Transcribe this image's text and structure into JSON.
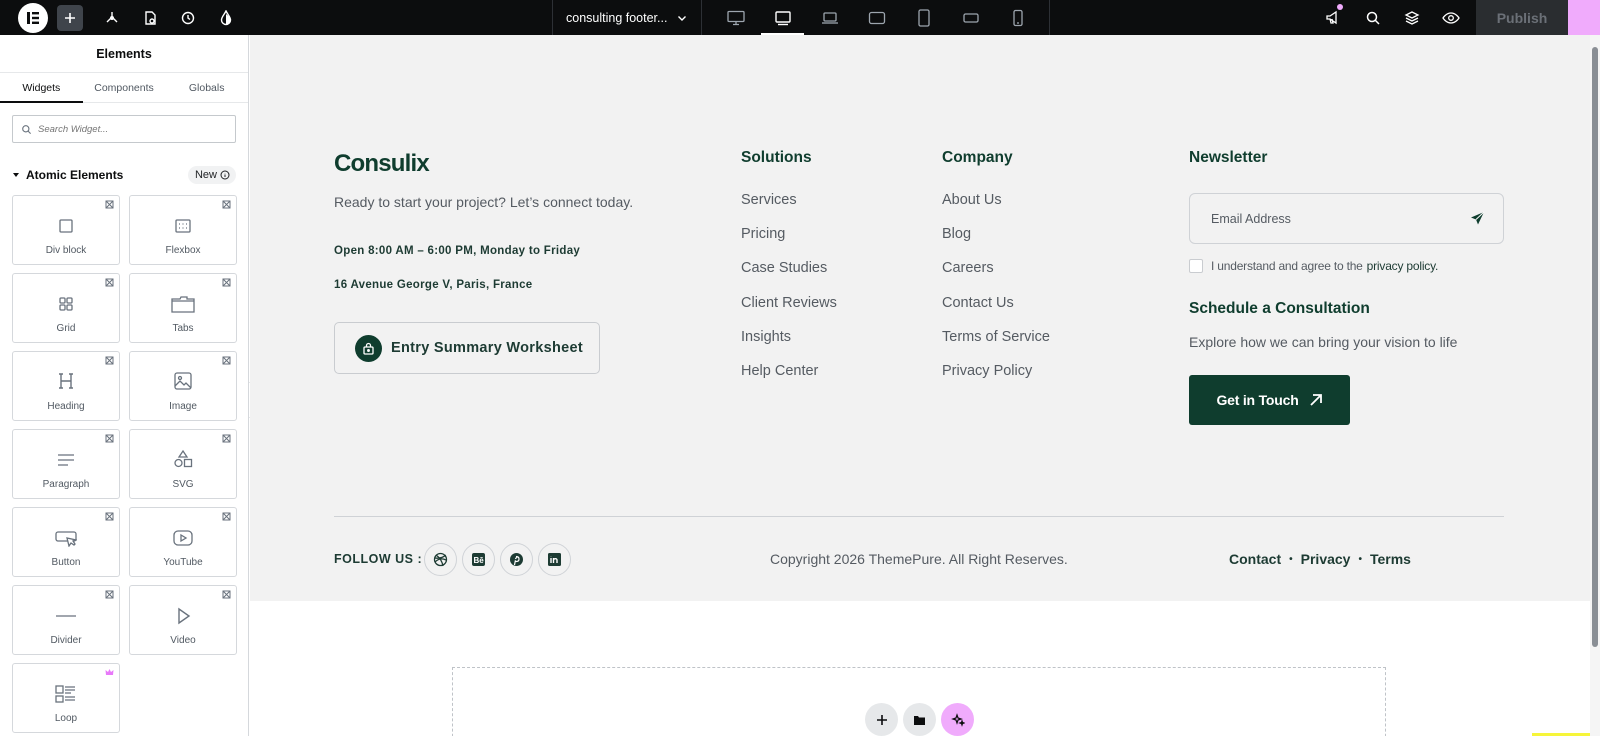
{
  "toolbar": {
    "doc_title": "consulting footer...",
    "publish_label": "Publish",
    "devices": [
      "desktop",
      "tablet-landscape",
      "laptop",
      "widescreen",
      "tablet",
      "mobile-landscape",
      "mobile"
    ],
    "active_device": "tablet-landscape"
  },
  "panel": {
    "title": "Elements",
    "tabs": [
      "Widgets",
      "Components",
      "Globals"
    ],
    "active_tab": "Widgets",
    "search_placeholder": "Search Widget...",
    "section_title": "Atomic Elements",
    "section_badge": "New",
    "widgets": [
      {
        "label": "Div block",
        "icon": "div-block-icon"
      },
      {
        "label": "Flexbox",
        "icon": "flexbox-icon"
      },
      {
        "label": "Grid",
        "icon": "grid-icon"
      },
      {
        "label": "Tabs",
        "icon": "tabs-icon"
      },
      {
        "label": "Heading",
        "icon": "heading-icon"
      },
      {
        "label": "Image",
        "icon": "image-icon"
      },
      {
        "label": "Paragraph",
        "icon": "paragraph-icon"
      },
      {
        "label": "SVG",
        "icon": "svg-icon"
      },
      {
        "label": "Button",
        "icon": "button-icon"
      },
      {
        "label": "YouTube",
        "icon": "youtube-icon"
      },
      {
        "label": "Divider",
        "icon": "divider-icon"
      },
      {
        "label": "Video",
        "icon": "video-icon"
      },
      {
        "label": "Loop",
        "icon": "loop-icon"
      }
    ]
  },
  "footer": {
    "brand": "Consulix",
    "tagline": "Ready to start your project? Let’s connect today.",
    "hours": "Open 8:00 AM – 6:00 PM, Monday to Friday",
    "address": "16 Avenue George V, Paris, France",
    "worksheet_label": "Entry Summary Worksheet",
    "solutions": {
      "title": "Solutions",
      "links": [
        "Services",
        "Pricing",
        "Case Studies",
        "Client Reviews",
        "Insights",
        "Help Center"
      ]
    },
    "company": {
      "title": "Company",
      "links": [
        "About Us",
        "Blog",
        "Careers",
        "Contact Us",
        "Terms of Service",
        "Privacy Policy"
      ]
    },
    "newsletter": {
      "title": "Newsletter",
      "email_placeholder": "Email Address",
      "agree_text": "I understand and agree to the",
      "agree_link": "privacy policy."
    },
    "schedule": {
      "title": "Schedule a Consultation",
      "subtitle": "Explore how we can bring your vision to life",
      "button_label": "Get in Touch"
    },
    "follow_label": "FOLLOW US :",
    "socials": [
      "dribbble-icon",
      "behance-icon",
      "pinterest-icon",
      "linkedin-icon"
    ],
    "copyright": "Copyright 2026 ThemePure. All Right Reserves.",
    "legal": [
      "Contact",
      "Privacy",
      "Terms"
    ]
  },
  "colors": {
    "brand_green": "#0f3d2e",
    "accent_pink": "#f0abfc",
    "topbar": "#0c0d0e"
  }
}
